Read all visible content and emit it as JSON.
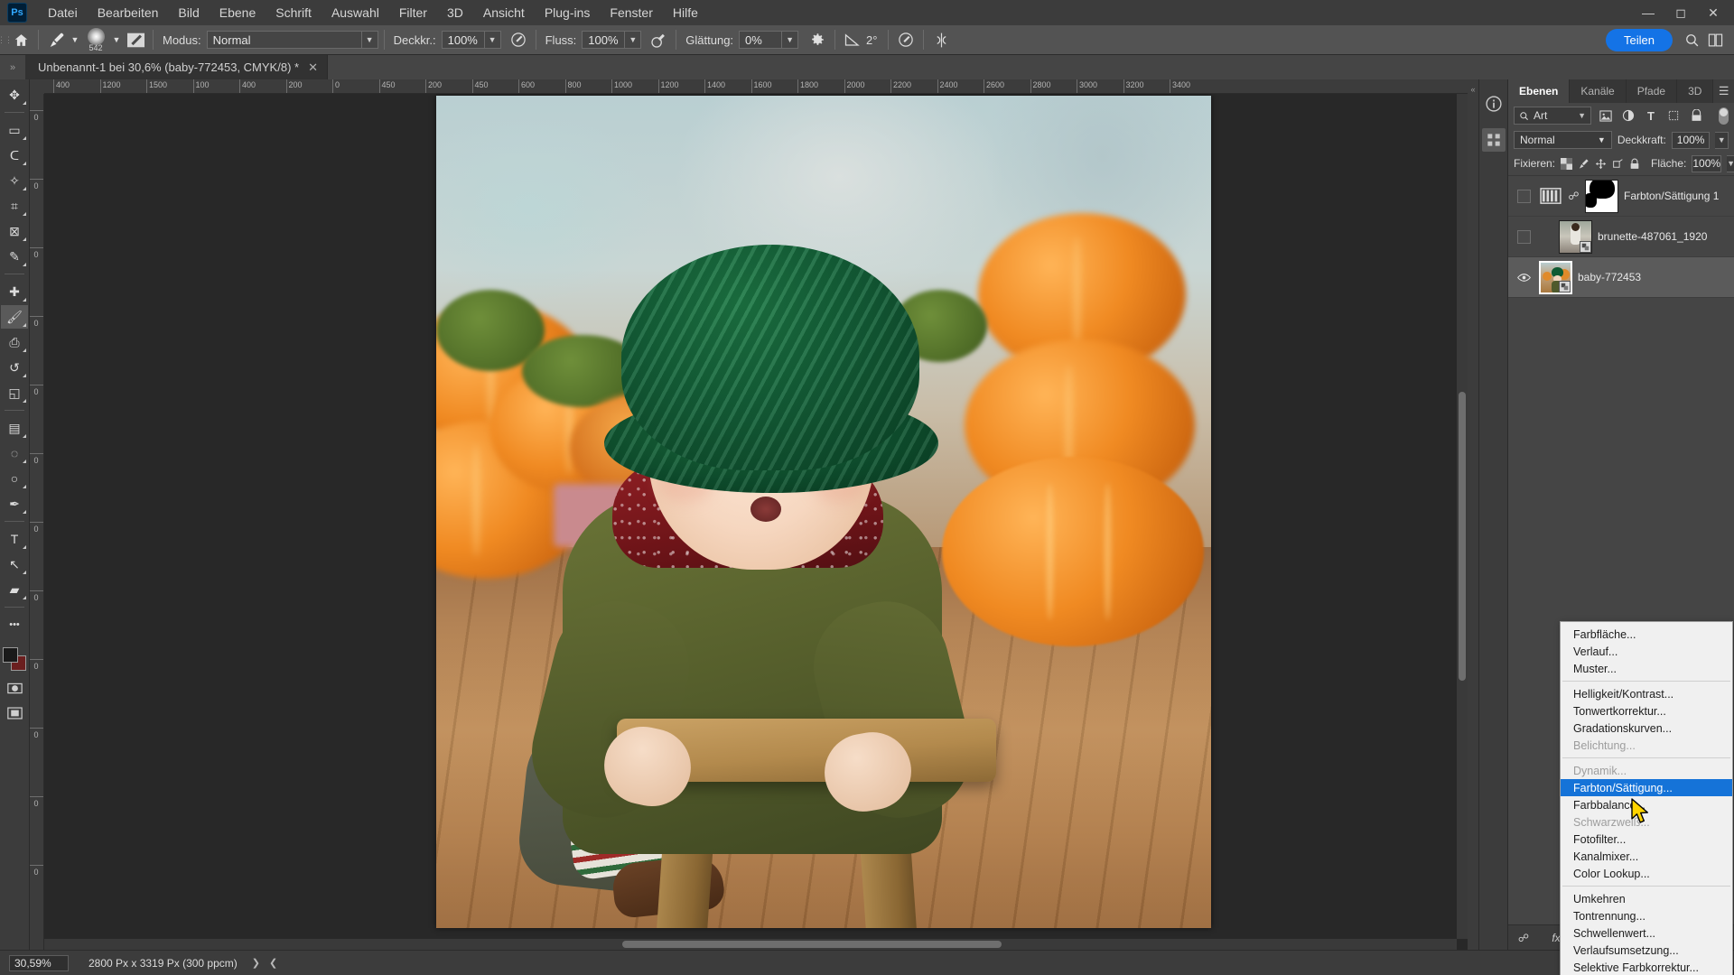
{
  "app": {
    "logo": "Ps",
    "menus": [
      "Datei",
      "Bearbeiten",
      "Bild",
      "Ebene",
      "Schrift",
      "Auswahl",
      "Filter",
      "3D",
      "Ansicht",
      "Plug-ins",
      "Fenster",
      "Hilfe"
    ],
    "window_controls": [
      "minimize",
      "maximize",
      "close"
    ]
  },
  "options_bar": {
    "home_icon": "home-icon",
    "brush_icon": "brush-icon",
    "brush_size": "542",
    "brush_preset_icon": "brush-preset-icon",
    "mode_label": "Modus:",
    "mode_value": "Normal",
    "opacity_label": "Deckkr.:",
    "opacity_value": "100%",
    "pressure_opacity_icon": "pressure-opacity-icon",
    "flow_label": "Fluss:",
    "flow_value": "100%",
    "airbrush_icon": "airbrush-icon",
    "smoothing_label": "Glättung:",
    "smoothing_value": "0%",
    "settings_icon": "gear-icon",
    "angle_icon": "angle-icon",
    "angle_value": "2°",
    "pressure_size_icon": "pressure-size-icon",
    "symmetry_icon": "symmetry-icon",
    "share_label": "Teilen",
    "search_icon": "search-icon",
    "arrange_icon": "arrange-icon"
  },
  "tab_bar": {
    "expand_icon": "chevron-double-right-icon",
    "document_title": "Unbenannt-1 bei 30,6% (baby-772453, CMYK/8) *",
    "close_icon": "close-icon"
  },
  "toolbar": {
    "tools": [
      {
        "name": "move-tool",
        "glyph": "✥",
        "active": false
      },
      {
        "name": "marquee-tool",
        "glyph": "▭",
        "active": false
      },
      {
        "name": "lasso-tool",
        "glyph": "ᑕ",
        "active": false
      },
      {
        "name": "object-selection-tool",
        "glyph": "✧",
        "active": false
      },
      {
        "name": "crop-tool",
        "glyph": "⌗",
        "active": false
      },
      {
        "name": "frame-tool",
        "glyph": "⊠",
        "active": false
      },
      {
        "name": "eyedropper-tool",
        "glyph": "✎",
        "active": false
      },
      {
        "name": "healing-brush-tool",
        "glyph": "✚",
        "active": false
      },
      {
        "name": "brush-tool",
        "glyph": "🖌",
        "active": true
      },
      {
        "name": "clone-stamp-tool",
        "glyph": "⎙",
        "active": false
      },
      {
        "name": "history-brush-tool",
        "glyph": "↺",
        "active": false
      },
      {
        "name": "eraser-tool",
        "glyph": "◱",
        "active": false
      },
      {
        "name": "gradient-tool",
        "glyph": "▤",
        "active": false
      },
      {
        "name": "blur-tool",
        "glyph": "◌",
        "active": false
      },
      {
        "name": "dodge-tool",
        "glyph": "○",
        "active": false
      },
      {
        "name": "pen-tool",
        "glyph": "✒",
        "active": false
      },
      {
        "name": "type-tool",
        "glyph": "T",
        "active": false
      },
      {
        "name": "path-selection-tool",
        "glyph": "↖",
        "active": false
      },
      {
        "name": "shape-tool",
        "glyph": "▰",
        "active": false
      },
      {
        "name": "more-tools",
        "glyph": "•••",
        "active": false
      }
    ],
    "foreground_color": "#1a1a1a",
    "background_color": "#6b1f1f",
    "quick-mask": "quick-mask-icon",
    "screen-mode": "screen-mode-icon"
  },
  "rulers": {
    "h_labels": [
      "400",
      "1200",
      "1500",
      "100",
      "400",
      "200",
      "0",
      "450",
      "200",
      "450",
      "600",
      "800",
      "1000",
      "1200",
      "1400",
      "1600",
      "1800",
      "2000",
      "2200",
      "2400",
      "2600",
      "2800",
      "3000",
      "3200",
      "3400"
    ],
    "v_labels": [
      "0",
      "0",
      "0",
      "0",
      "0",
      "0",
      "0",
      "0",
      "0",
      "0",
      "0",
      "0"
    ],
    "unit": "Px"
  },
  "layers_panel": {
    "tabs": [
      {
        "label": "Ebenen",
        "active": true
      },
      {
        "label": "Kanäle",
        "active": false
      },
      {
        "label": "Pfade",
        "active": false
      },
      {
        "label": "3D",
        "active": false
      }
    ],
    "menu_icon": "panel-menu-icon",
    "filter": {
      "search_icon": "search-icon",
      "kind_value": "Art",
      "caret": "chevron-down-icon",
      "icons": [
        "image-filter-icon",
        "adjustment-filter-icon",
        "type-filter-icon",
        "shape-filter-icon",
        "smart-object-filter-icon"
      ],
      "toggle": "filter-toggle"
    },
    "blend_mode": "Normal",
    "opacity_label": "Deckkraft:",
    "opacity_value": "100%",
    "lock_label": "Fixieren:",
    "lock_icons": [
      "lock-transparency-icon",
      "lock-image-icon",
      "lock-position-icon",
      "lock-artboard-icon",
      "lock-all-icon"
    ],
    "fill_label": "Fläche:",
    "fill_value": "100%",
    "layers": [
      {
        "name": "Farbton/Sättigung 1",
        "visible": false,
        "selected": false,
        "type": "adjustment",
        "has_mask": true,
        "linked": true
      },
      {
        "name": "brunette-487061_1920",
        "visible": false,
        "selected": false,
        "type": "smart-object",
        "has_mask": false,
        "linked": false
      },
      {
        "name": "baby-772453",
        "visible": true,
        "selected": true,
        "type": "smart-object",
        "has_mask": false,
        "linked": false
      }
    ],
    "footer_icons": [
      "link-layers-icon",
      "layer-style-icon",
      "add-mask-icon",
      "new-adjustment-icon",
      "new-group-icon",
      "new-layer-icon",
      "delete-layer-icon"
    ]
  },
  "dock": {
    "icons": [
      "info-icon",
      "actions-icon"
    ]
  },
  "context_menu": {
    "groups": [
      [
        {
          "label": "Farbfläche...",
          "state": "normal"
        },
        {
          "label": "Verlauf...",
          "state": "normal"
        },
        {
          "label": "Muster...",
          "state": "normal"
        }
      ],
      [
        {
          "label": "Helligkeit/Kontrast...",
          "state": "normal"
        },
        {
          "label": "Tonwertkorrektur...",
          "state": "normal"
        },
        {
          "label": "Gradationskurven...",
          "state": "normal"
        },
        {
          "label": "Belichtung...",
          "state": "disabled"
        }
      ],
      [
        {
          "label": "Dynamik...",
          "state": "disabled"
        },
        {
          "label": "Farbton/Sättigung...",
          "state": "highlighted"
        },
        {
          "label": "Farbbalance...",
          "state": "normal"
        },
        {
          "label": "Schwarzweiß...",
          "state": "disabled"
        },
        {
          "label": "Fotofilter...",
          "state": "normal"
        },
        {
          "label": "Kanalmixer...",
          "state": "normal"
        },
        {
          "label": "Color Lookup...",
          "state": "normal"
        }
      ],
      [
        {
          "label": "Umkehren",
          "state": "normal"
        },
        {
          "label": "Tontrennung...",
          "state": "normal"
        },
        {
          "label": "Schwellenwert...",
          "state": "normal"
        },
        {
          "label": "Verlaufsumsetzung...",
          "state": "normal"
        },
        {
          "label": "Selektive Farbkorrektur...",
          "state": "normal"
        }
      ]
    ]
  },
  "status_bar": {
    "zoom_value": "30,59%",
    "doc_dimensions": "2800 Px x 3319 Px (300 ppcm)",
    "next_arrow": "chevron-right-icon",
    "prev_arrow": "chevron-left-icon"
  },
  "colors": {
    "accent_blue": "#1473e6",
    "highlight_blue": "#1573d8",
    "panel_bg": "#454545",
    "chrome_bg": "#3c3c3c",
    "canvas_bg": "#282828"
  }
}
